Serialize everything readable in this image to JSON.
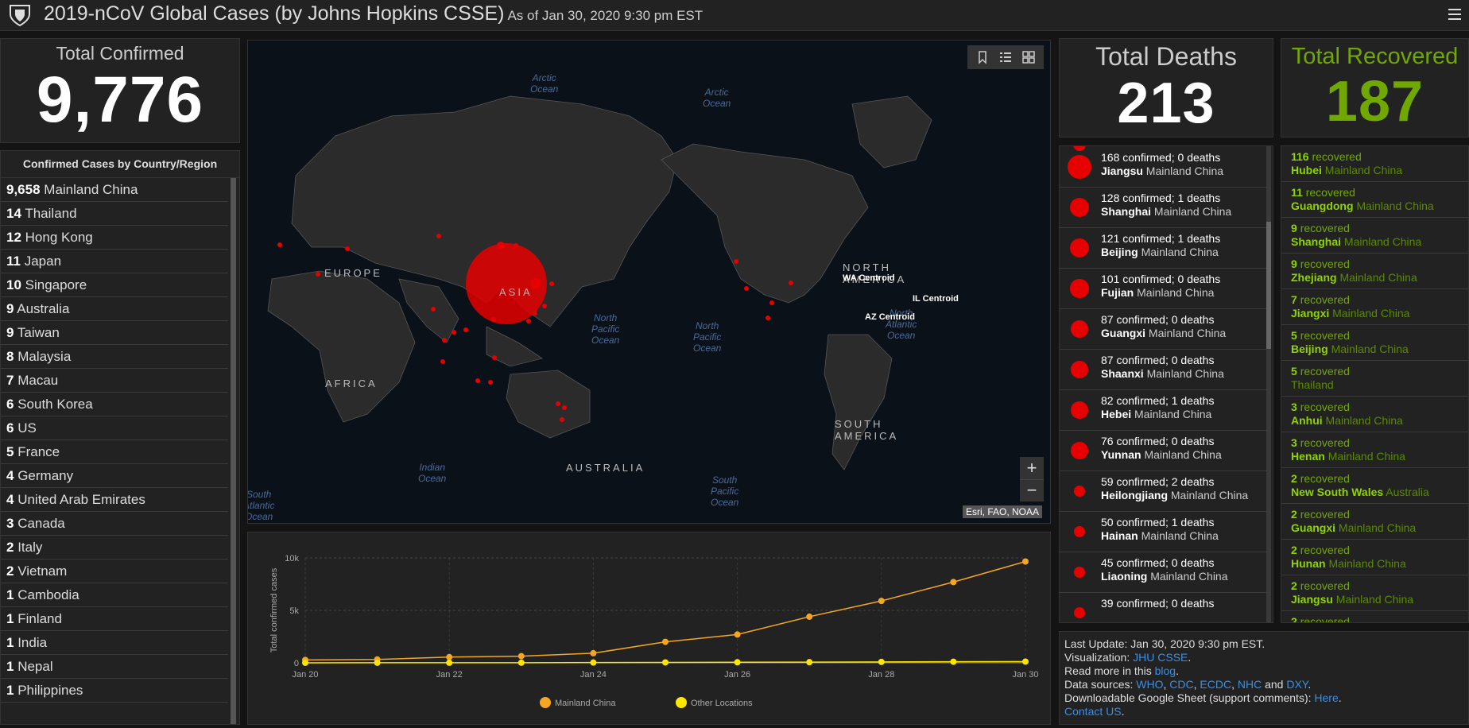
{
  "header": {
    "title": "2019-nCoV Global Cases (by Johns Hopkins CSSE)",
    "subtitle": "As of Jan 30, 2020 9:30 pm EST"
  },
  "total_confirmed": {
    "label": "Total Confirmed",
    "value": "9,776"
  },
  "total_deaths": {
    "label": "Total Deaths",
    "value": "213"
  },
  "total_recovered": {
    "label": "Total Recovered",
    "value": "187"
  },
  "country_list": {
    "heading": "Confirmed Cases by Country/Region",
    "items": [
      {
        "count": "9,658",
        "name": "Mainland China"
      },
      {
        "count": "14",
        "name": "Thailand"
      },
      {
        "count": "12",
        "name": "Hong Kong"
      },
      {
        "count": "11",
        "name": "Japan"
      },
      {
        "count": "10",
        "name": "Singapore"
      },
      {
        "count": "9",
        "name": "Australia"
      },
      {
        "count": "9",
        "name": "Taiwan"
      },
      {
        "count": "8",
        "name": "Malaysia"
      },
      {
        "count": "7",
        "name": "Macau"
      },
      {
        "count": "6",
        "name": "South Korea"
      },
      {
        "count": "6",
        "name": "US"
      },
      {
        "count": "5",
        "name": "France"
      },
      {
        "count": "4",
        "name": "Germany"
      },
      {
        "count": "4",
        "name": "United Arab Emirates"
      },
      {
        "count": "3",
        "name": "Canada"
      },
      {
        "count": "2",
        "name": "Italy"
      },
      {
        "count": "2",
        "name": "Vietnam"
      },
      {
        "count": "1",
        "name": "Cambodia"
      },
      {
        "count": "1",
        "name": "Finland"
      },
      {
        "count": "1",
        "name": "India"
      },
      {
        "count": "1",
        "name": "Nepal"
      },
      {
        "count": "1",
        "name": "Philippines"
      }
    ]
  },
  "deaths_list": [
    {
      "confirmed": "168",
      "deaths": "0",
      "province": "Jiangsu",
      "region": "Mainland China",
      "r": 1
    },
    {
      "confirmed": "128",
      "deaths": "1",
      "province": "Shanghai",
      "region": "Mainland China",
      "r": 0.82
    },
    {
      "confirmed": "121",
      "deaths": "1",
      "province": "Beijing",
      "region": "Mainland China",
      "r": 0.8
    },
    {
      "confirmed": "101",
      "deaths": "0",
      "province": "Fujian",
      "region": "Mainland China",
      "r": 0.78
    },
    {
      "confirmed": "87",
      "deaths": "0",
      "province": "Guangxi",
      "region": "Mainland China",
      "r": 0.72
    },
    {
      "confirmed": "87",
      "deaths": "0",
      "province": "Shaanxi",
      "region": "Mainland China",
      "r": 0.72
    },
    {
      "confirmed": "82",
      "deaths": "1",
      "province": "Hebei",
      "region": "Mainland China",
      "r": 0.72
    },
    {
      "confirmed": "76",
      "deaths": "0",
      "province": "Yunnan",
      "region": "Mainland China",
      "r": 0.72
    },
    {
      "confirmed": "59",
      "deaths": "2",
      "province": "Heilongjiang",
      "region": "Mainland China",
      "r": 0.46
    },
    {
      "confirmed": "50",
      "deaths": "1",
      "province": "Hainan",
      "region": "Mainland China",
      "r": 0.46
    },
    {
      "confirmed": "45",
      "deaths": "0",
      "province": "Liaoning",
      "region": "Mainland China",
      "r": 0.46
    },
    {
      "confirmed": "39",
      "deaths": "0",
      "province": "",
      "region": "",
      "r": 0.46
    }
  ],
  "labels": {
    "confirmed_word": "confirmed",
    "deaths_word": "deaths",
    "recovered_word": "recovered"
  },
  "recovered_list": [
    {
      "count": "116",
      "province": "Hubei",
      "region": "Mainland China"
    },
    {
      "count": "11",
      "province": "Guangdong",
      "region": "Mainland China"
    },
    {
      "count": "9",
      "province": "Shanghai",
      "region": "Mainland China"
    },
    {
      "count": "9",
      "province": "Zhejiang",
      "region": "Mainland China"
    },
    {
      "count": "7",
      "province": "Jiangxi",
      "region": "Mainland China"
    },
    {
      "count": "5",
      "province": "Beijing",
      "region": "Mainland China"
    },
    {
      "count": "5",
      "province": "",
      "region": "Thailand"
    },
    {
      "count": "3",
      "province": "Anhui",
      "region": "Mainland China"
    },
    {
      "count": "3",
      "province": "Henan",
      "region": "Mainland China"
    },
    {
      "count": "2",
      "province": "New South Wales",
      "region": "Australia"
    },
    {
      "count": "2",
      "province": "Guangxi",
      "region": "Mainland China"
    },
    {
      "count": "2",
      "province": "Hunan",
      "region": "Mainland China"
    },
    {
      "count": "2",
      "province": "Jiangsu",
      "region": "Mainland China"
    },
    {
      "count": "2",
      "province": "",
      "region": ""
    }
  ],
  "map": {
    "oceans": [
      "Arctic\nOcean",
      "Arctic\nOcean",
      "North\nPacific\nOcean",
      "North\nPacific\nOcean",
      "North\nAtlantic\nOcean",
      "Indian\nOcean",
      "South\nPacific\nOcean",
      "South\nAtlantic\nOcean"
    ],
    "continents": [
      "EUROPE",
      "ASIA",
      "AFRICA",
      "AUSTRALIA",
      "NORTH\nAMERICA",
      "SOUTH\nAMERICA"
    ],
    "centroids": [
      "WA Centroid",
      "IL Centroid",
      "AZ Centroid"
    ],
    "attribution": "Esri, FAO, NOAA",
    "zoom_in": "+",
    "zoom_out": "−",
    "colors": {
      "case_circle": "#e60000",
      "land": "#2b2b2b",
      "water": "#0b1119"
    }
  },
  "chart_data": {
    "type": "line",
    "x": [
      "Jan 20",
      "Jan 21",
      "Jan 22",
      "Jan 23",
      "Jan 24",
      "Jan 25",
      "Jan 26",
      "Jan 27",
      "Jan 28",
      "Jan 29",
      "Jan 30"
    ],
    "x_ticks": [
      "Jan 20",
      "Jan 22",
      "Jan 24",
      "Jan 26",
      "Jan 28",
      "Jan 30"
    ],
    "y_ticks": [
      "0",
      "5k",
      "10k"
    ],
    "ylim": [
      0,
      10000
    ],
    "ylabel": "Total confirmed cases",
    "series": [
      {
        "name": "Mainland China",
        "color": "#f5a623",
        "values": [
          278,
          326,
          547,
          639,
          916,
          2000,
          2700,
          4400,
          5900,
          7700,
          9658
        ]
      },
      {
        "name": "Other Locations",
        "color": "#ffe600",
        "values": [
          4,
          6,
          8,
          14,
          25,
          40,
          57,
          64,
          87,
          105,
          118
        ]
      }
    ],
    "legend": "bottom",
    "grid": true
  },
  "info": {
    "last_update": "Last Update: Jan 30, 2020 9:30 pm EST.",
    "visualization_prefix": "Visualization:",
    "visualization_link": "JHU CSSE",
    "read_more_prefix": "Read more in this",
    "read_more_link": "blog",
    "sources_prefix": "Data sources:",
    "sources": [
      "WHO",
      "CDC",
      "ECDC",
      "NHC",
      "DXY"
    ],
    "and_word": "and",
    "sheet_prefix": "Downloadable Google Sheet (support comments):",
    "sheet_link": "Here",
    "contact_link": "Contact US"
  }
}
